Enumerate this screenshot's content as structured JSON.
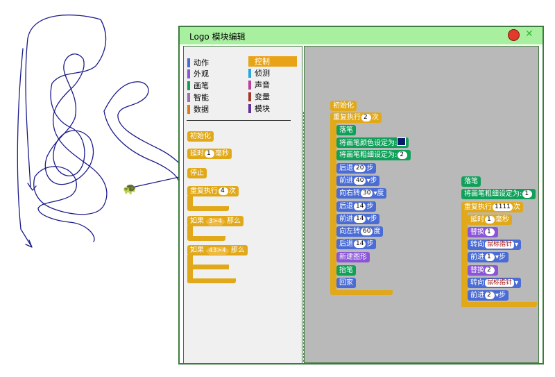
{
  "window": {
    "title": "Logo 模块编辑",
    "close_icon": "red-circle",
    "maximize_icon": "green-x"
  },
  "palette": {
    "categories": [
      {
        "label": "动作",
        "color": "#4a6cd4"
      },
      {
        "label": "控制",
        "color": "#e1a91a",
        "selected": true
      },
      {
        "label": "外观",
        "color": "#8a55d7"
      },
      {
        "label": "侦测",
        "color": "#2ca5e2"
      },
      {
        "label": "画笔",
        "color": "#11a05a"
      },
      {
        "label": "声音",
        "color": "#bb3f9e"
      },
      {
        "label": "智能",
        "color": "#a06db0"
      },
      {
        "label": "变量",
        "color": "#a13829"
      },
      {
        "label": "数据",
        "color": "#e07a1f"
      },
      {
        "label": "模块",
        "color": "#63309c"
      }
    ],
    "blocks": {
      "init": "初始化",
      "wait_prefix": "延时",
      "wait_value": "1",
      "wait_suffix": "毫秒",
      "stop": "停止",
      "repeat_prefix": "重复执行",
      "repeat_value": "4",
      "repeat_suffix": "次",
      "if1_prefix": "如果",
      "if1_cond": "3>4",
      "if1_suffix": "那么",
      "if2_prefix": "如果",
      "if2_cond": "43>4",
      "if2_suffix": "那么"
    }
  },
  "script1": {
    "init": "初始化",
    "repeat_prefix": "重复执行",
    "repeat_value": "2",
    "repeat_suffix": "次",
    "pen_down": "落笔",
    "set_color": "将画笔颜色设定为:",
    "pen_color": "#0a1a6a",
    "set_width": "将画笔粗细设定为:",
    "width_value": "2",
    "back1_prefix": "后退",
    "back1_value": "20",
    "back1_suffix": "步",
    "fwd1_prefix": "前进",
    "fwd1_value": "40",
    "fwd1_suffix": "步",
    "right_prefix": "向右转",
    "right_value": "30",
    "right_suffix": "度",
    "back2_prefix": "后退",
    "back2_value": "14",
    "back2_suffix": "步",
    "fwd2_prefix": "前进",
    "fwd2_value": "14",
    "fwd2_suffix": "步",
    "left_prefix": "向左转",
    "left_value": "60",
    "left_suffix": "度",
    "back3_prefix": "后退",
    "back3_value": "14",
    "back3_suffix": "步",
    "new_shape": "新建图形",
    "pen_up": "抬笔",
    "home": "回家"
  },
  "script2": {
    "pen_down": "落笔",
    "set_width": "将画笔粗细设定为:",
    "width_value": "1",
    "repeat_prefix": "重复执行",
    "repeat_value": "1111",
    "repeat_suffix": "次",
    "wait_prefix": "延时",
    "wait_value": "1",
    "wait_suffix": "毫秒",
    "swap1_prefix": "替换",
    "swap1_value": "1",
    "point1_prefix": "转向",
    "point1_target": "鼠标指针",
    "fwd1_prefix": "前进",
    "fwd1_value": "1",
    "fwd1_suffix": "步",
    "swap2_prefix": "替换",
    "swap2_value": "2",
    "point2_prefix": "转向",
    "point2_target": "鼠标指针",
    "fwd2_prefix": "前进",
    "fwd2_value": "2",
    "fwd2_suffix": "步"
  },
  "stage": {
    "pen_trail_color": "#1a1a8a",
    "turtle_icon": "turtle-icon"
  }
}
